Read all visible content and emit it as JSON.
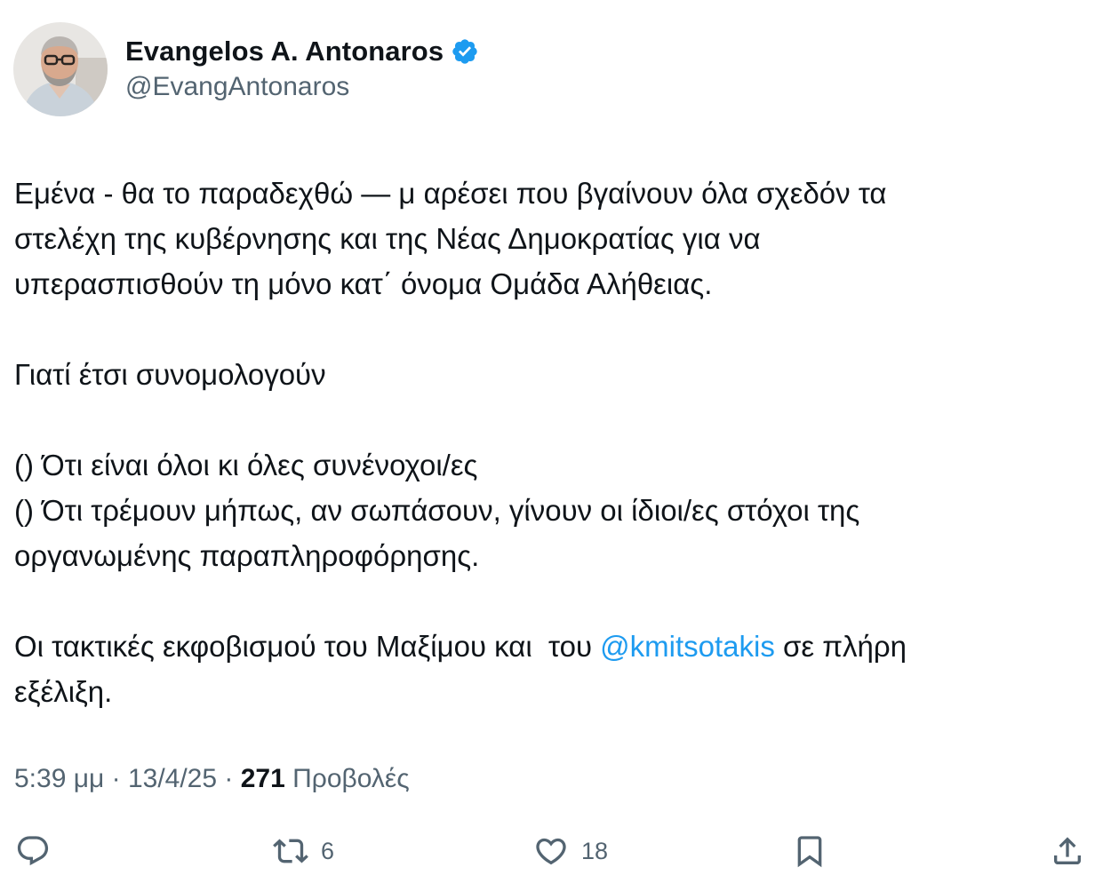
{
  "author": {
    "display_name": "Evangelos A. Antonaros",
    "handle": "@EvangAntonaros",
    "verified": true,
    "avatar_icon": "profile-photo"
  },
  "tweet": {
    "para1": {
      "line1": "Εμένα - θα το παραδεχθώ — μ αρέσει που βγαίνουν όλα σχεδόν τα",
      "line2": "στελέχη της κυβέρνησης και της Νέας Δημοκρατίας για να",
      "line3": "υπερασπισθούν τη μόνο κατ΄ όνομα Ομάδα Αλήθειας."
    },
    "para2": "Γιατί έτσι συνομολογούν",
    "para3": {
      "line1": "() Ότι είναι όλοι κι όλες συνένοχοι/ες",
      "line2": "() Ότι τρέμουν μήπως, αν σωπάσουν, γίνουν οι ίδιοι/ες στόχοι της",
      "line3": "οργανωμένης παραπληροφόρησης."
    },
    "para4": {
      "line1_before": "Οι τακτικές εκφοβισμού του Μαξίμου και  του ",
      "mention": "@kmitsotakis",
      "line1_after": " σε πλήρη",
      "line2": "εξέλιξη."
    }
  },
  "meta": {
    "time_date": "5:39 μμ · 13/4/25 · ",
    "views_count": "271",
    "views_label": " Προβολές"
  },
  "actions": {
    "reply": {
      "icon": "reply-icon",
      "count": ""
    },
    "retweet": {
      "icon": "retweet-icon",
      "count": "6"
    },
    "like": {
      "icon": "heart-icon",
      "count": "18"
    },
    "bookmark": {
      "icon": "bookmark-icon",
      "count": ""
    },
    "share": {
      "icon": "share-icon",
      "count": ""
    }
  },
  "colors": {
    "text": "#0f1419",
    "secondary": "#536471",
    "link": "#1d9bf0",
    "verified_badge": "#1d9bf0"
  }
}
